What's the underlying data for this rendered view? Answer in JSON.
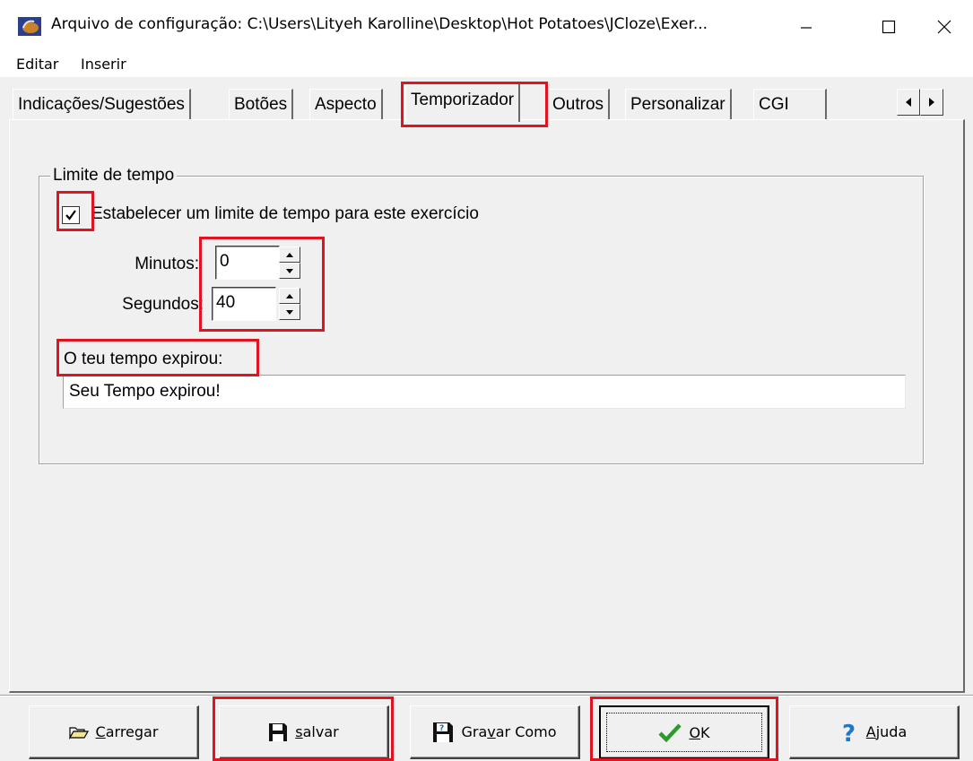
{
  "window": {
    "title": "Arquivo de configuração: C:\\Users\\Lityeh Karolline\\Desktop\\Hot Potatoes\\JCloze\\Exer...",
    "icon": "hot-potatoes-icon",
    "controls": [
      "minimize-icon",
      "maximize-icon",
      "close-icon"
    ]
  },
  "menu": {
    "editar": "Editar",
    "inserir": "Inserir"
  },
  "tabs": [
    {
      "label": "Indicações/Sugestões"
    },
    {
      "label": "Botões"
    },
    {
      "label": "Aspecto"
    },
    {
      "label": "Temporizador",
      "selected": true
    },
    {
      "label": "Outros"
    },
    {
      "label": "Personalizar"
    },
    {
      "label": "CGI"
    }
  ],
  "group": {
    "legend": "Limite de tempo",
    "checkbox_label": "Estabelecer um limite de tempo para este exercício",
    "checkbox_checked": true,
    "minutos_label": "Minutos:",
    "minutos_value": "0",
    "segundos_label": "Segundos:",
    "segundos_value": "40",
    "expired_label": "O teu tempo expirou:",
    "expired_value": "Seu Tempo expirou!"
  },
  "buttons": {
    "carregar": {
      "pre": "",
      "u": "C",
      "post": "arregar",
      "icon": "folder-open-icon"
    },
    "salvar": {
      "pre": "",
      "u": "s",
      "post": "alvar",
      "icon": "floppy-disk-icon"
    },
    "gravar": {
      "pre": "Gra",
      "u": "v",
      "post": "ar Como",
      "icon": "save-as-icon"
    },
    "ok": {
      "pre": "",
      "u": "O",
      "post": "K",
      "icon": "checkmark-icon"
    },
    "ajuda": {
      "pre": "",
      "u": "A",
      "post": "juda",
      "icon": "question-mark-icon"
    }
  },
  "colors": {
    "highlight": "#e0141e",
    "face": "#f0f0f0",
    "check_green": "#2e9a2e",
    "help_blue": "#1e78c8"
  }
}
